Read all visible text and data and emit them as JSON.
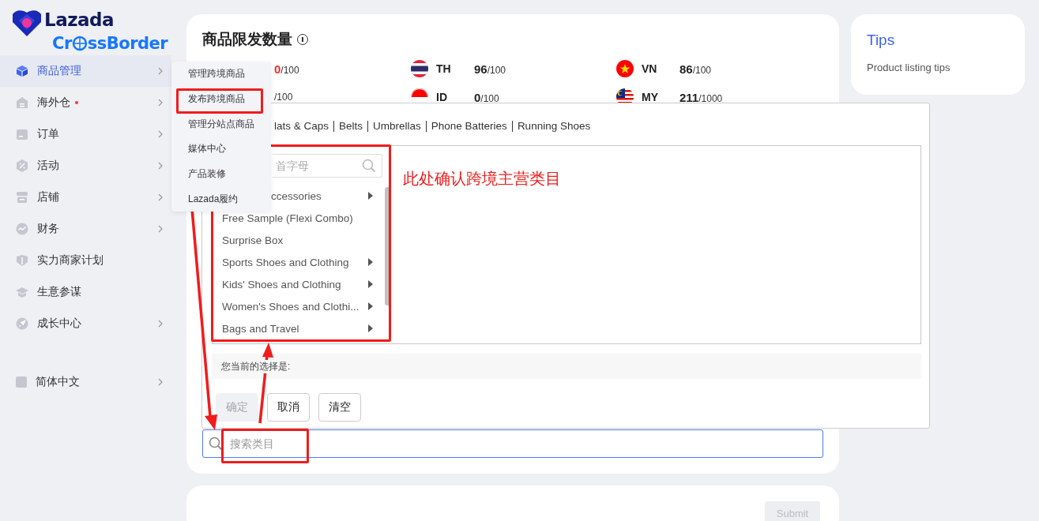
{
  "brand": {
    "name": "Lazada",
    "sub_before": "Cr",
    "sub_after": "ssBorder"
  },
  "sidebar": {
    "items": [
      {
        "label": "商品管理",
        "selected": true,
        "expandable": true,
        "dot": false
      },
      {
        "label": "海外仓",
        "selected": false,
        "expandable": true,
        "dot": true
      },
      {
        "label": "订单",
        "selected": false,
        "expandable": true,
        "dot": false
      },
      {
        "label": "活动",
        "selected": false,
        "expandable": true,
        "dot": false
      },
      {
        "label": "店铺",
        "selected": false,
        "expandable": true,
        "dot": false
      },
      {
        "label": "财务",
        "selected": false,
        "expandable": true,
        "dot": false
      },
      {
        "label": "实力商家计划",
        "selected": false,
        "expandable": false,
        "dot": false
      },
      {
        "label": "生意参谋",
        "selected": false,
        "expandable": false,
        "dot": false
      },
      {
        "label": "成长中心",
        "selected": false,
        "expandable": true,
        "dot": false
      }
    ],
    "language": {
      "label": "简体中文",
      "expandable": true
    }
  },
  "submenu": {
    "items": [
      "管理跨境商品",
      "发布跨境商品",
      "管理分站点商品",
      "媒体中心",
      "产品装修",
      "Lazada履约"
    ]
  },
  "quota": {
    "title": "商品限发数量",
    "rows": [
      [
        {
          "used": "0",
          "limit": "/100",
          "warning": true
        },
        {
          "code": "TH",
          "kind": "th",
          "used": "96",
          "limit": "/100",
          "warning": false
        },
        {
          "code": "VN",
          "kind": "vn",
          "used": "86",
          "limit": "/100",
          "warning": false
        }
      ],
      [
        {
          "limit": "/100"
        },
        {
          "code": "ID",
          "kind": "id",
          "used": "0",
          "limit": "/100",
          "warning": false
        },
        {
          "code": "MY",
          "kind": "my",
          "used": "211",
          "limit": "/1000",
          "warning": false
        }
      ]
    ]
  },
  "tips": {
    "title": "Tips",
    "text": "Product listing tips"
  },
  "category_picker": {
    "recent": [
      "lats & Caps",
      "Belts",
      "Umbrellas",
      "Phone Batteries",
      "Running Shoes"
    ],
    "search": {
      "placeholder": "首字母"
    },
    "categories": [
      {
        "label": "ccessories",
        "has_children": true
      },
      {
        "label": "Free Sample (Flexi Combo)",
        "has_children": false
      },
      {
        "label": "Surprise Box",
        "has_children": false
      },
      {
        "label": "Sports Shoes and Clothing",
        "has_children": true
      },
      {
        "label": "Kids' Shoes and Clothing",
        "has_children": true
      },
      {
        "label": "Women's Shoes and Clothi...",
        "has_children": true
      },
      {
        "label": "Bags and Travel",
        "has_children": true
      }
    ],
    "note": "此处确认跨境主营类目",
    "selection_label": "您当前的选择是:",
    "buttons": [
      {
        "label": "确定",
        "disabled": true
      },
      {
        "label": "取消",
        "disabled": false
      },
      {
        "label": "清空",
        "disabled": false
      }
    ]
  },
  "category_search": {
    "placeholder": "搜索类目"
  },
  "submit": {
    "label": "Submit",
    "disabled": true
  }
}
